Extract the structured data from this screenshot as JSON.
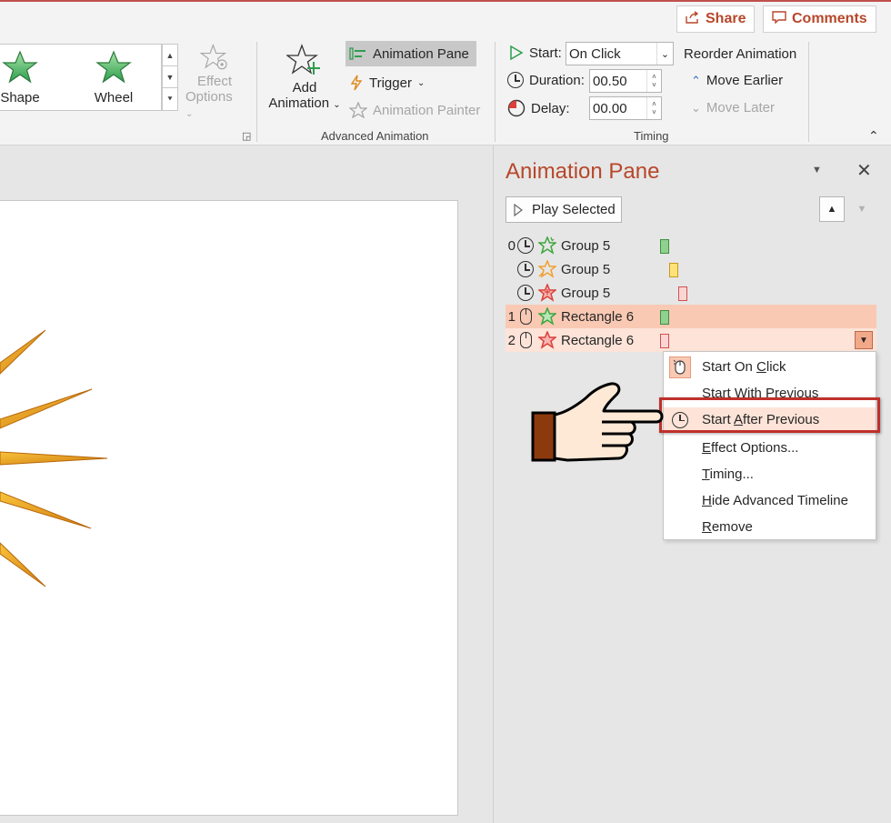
{
  "topbar": {
    "share_label": "Share",
    "comments_label": "Comments"
  },
  "ribbon": {
    "gallery": {
      "items": [
        {
          "label": "Shape"
        },
        {
          "label": "Wheel"
        }
      ]
    },
    "effect_options": {
      "line1": "Effect",
      "line2": "Options"
    },
    "add_animation": {
      "line1": "Add",
      "line2": "Animation"
    },
    "animation_pane_label": "Animation Pane",
    "trigger_label": "Trigger",
    "animation_painter_label": "Animation Painter",
    "advanced_animation_group": "Advanced Animation",
    "timing": {
      "start_label": "Start:",
      "start_value": "On Click",
      "duration_label": "Duration:",
      "duration_value": "00.50",
      "delay_label": "Delay:",
      "delay_value": "00.00",
      "reorder_label": "Reorder Animation",
      "move_earlier_label": "Move Earlier",
      "move_later_label": "Move Later",
      "group_label": "Timing"
    }
  },
  "pane": {
    "title": "Animation Pane",
    "play_selected_label": "Play Selected",
    "items": [
      {
        "num": "0",
        "name": "Group 5",
        "trigger": "clock",
        "effect_color": "#3ea53e",
        "bar_color": "#8fd18f",
        "bar_border": "#3f8f3f"
      },
      {
        "num": "",
        "name": "Group 5",
        "trigger": "clock",
        "effect_color": "#f0a030",
        "bar_color": "#ffe37a",
        "bar_border": "#c99a1a"
      },
      {
        "num": "",
        "name": "Group 5",
        "trigger": "clock",
        "effect_color": "#d9413a",
        "bar_color": "#fbd4d4",
        "bar_border": "#d05050"
      },
      {
        "num": "1",
        "name": "Rectangle 6",
        "trigger": "mouse",
        "effect_color": "#3ea53e",
        "bar_color": "#8fd18f",
        "bar_border": "#3f8f3f"
      },
      {
        "num": "2",
        "name": "Rectangle 6",
        "trigger": "mouse",
        "effect_color": "#d9413a",
        "bar_color": "#fbd4d4",
        "bar_border": "#d05050"
      }
    ]
  },
  "context_menu": {
    "start_on_click": {
      "pre": "Start On ",
      "accel": "C",
      "post": "lick"
    },
    "start_with_previous": "Start With Previous",
    "start_after_previous": {
      "pre": "Start ",
      "accel": "A",
      "post": "fter Previous"
    },
    "effect_options": {
      "pre": "",
      "accel": "E",
      "post": "ffect Options..."
    },
    "timing": {
      "pre": "",
      "accel": "T",
      "post": "iming..."
    },
    "hide_timeline": {
      "pre": "",
      "accel": "H",
      "post": "ide Advanced Timeline"
    },
    "remove": {
      "pre": "",
      "accel": "R",
      "post": "emove"
    }
  },
  "colors": {
    "accent": "#b7472a",
    "selected_row": "#f9c9b4",
    "selected_row_light": "#fde3d8",
    "highlight_box": "#c0302b"
  }
}
